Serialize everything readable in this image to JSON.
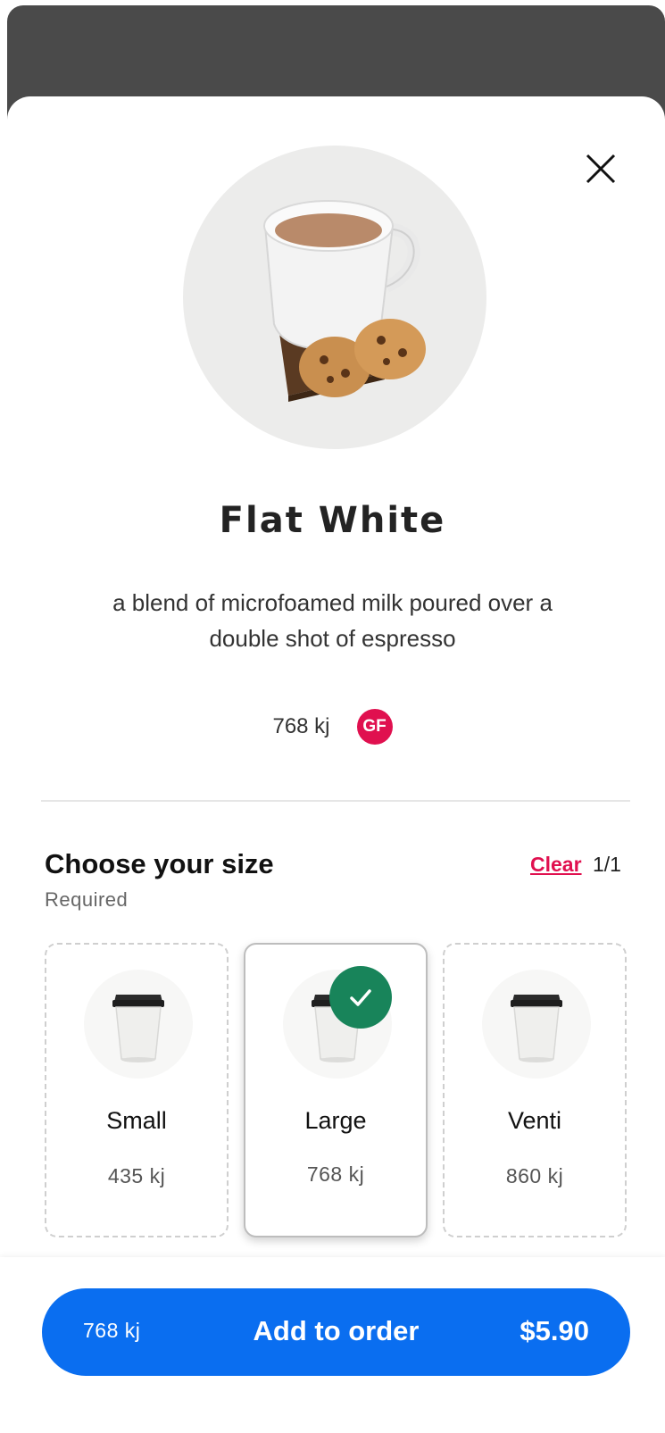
{
  "product": {
    "title": "Flat White",
    "description": "a blend of microfoamed milk poured over a double shot of espresso",
    "energy": "768 kj",
    "dietary_badge": "GF"
  },
  "icons": {
    "close": "close-icon",
    "check": "check-icon",
    "hero": "coffee-cup-with-cookies-image",
    "cup": "takeaway-cup-image"
  },
  "size_section": {
    "title": "Choose your size",
    "subtitle": "Required",
    "clear_label": "Clear",
    "counter": "1/1",
    "options": [
      {
        "name": "Small",
        "energy": "435 kj",
        "selected": false
      },
      {
        "name": "Large",
        "energy": "768 kj",
        "selected": true
      },
      {
        "name": "Venti",
        "energy": "860 kj",
        "selected": false
      }
    ]
  },
  "order_button": {
    "energy": "768 kj",
    "label": "Add to order",
    "price": "$5.90"
  },
  "colors": {
    "accent_blue": "#0a6ef0",
    "badge_red": "#e0104f",
    "check_green": "#18845a",
    "backdrop": "#4a4a4a"
  }
}
